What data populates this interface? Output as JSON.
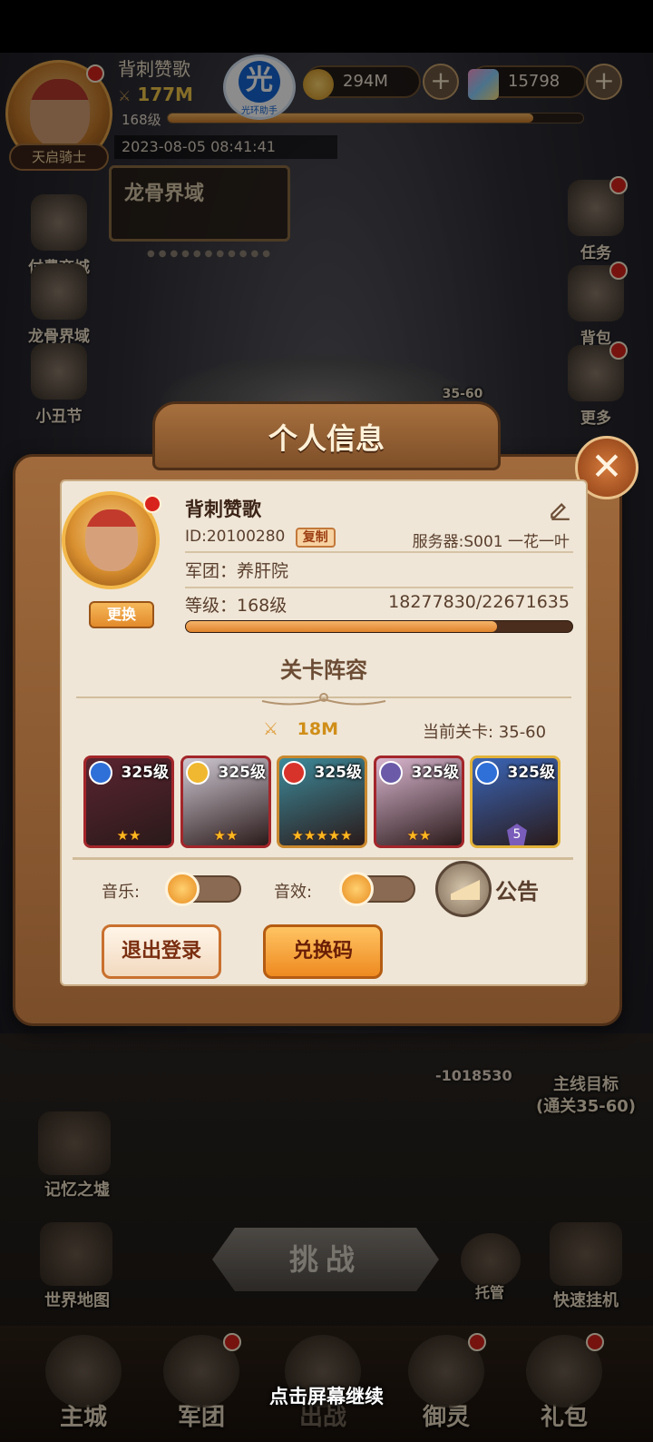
{
  "hud": {
    "player_name": "背刺赞歌",
    "power": "177M",
    "level": "168级",
    "title_tag": "天启骑士",
    "datetime": "2023-08-05 08:41:41",
    "logo_glyph": "光",
    "logo_text": "光环助手",
    "gold": "294M",
    "gems": "15798",
    "xp_fraction": 0.88
  },
  "left_sidebar": {
    "items": [
      {
        "label": "付费商城"
      },
      {
        "label": "龙骨界域"
      },
      {
        "label": "小丑节"
      }
    ],
    "banner_label": "龙骨界域"
  },
  "right_sidebar": {
    "items": [
      {
        "label": "任务"
      },
      {
        "label": "背包"
      },
      {
        "label": "更多"
      }
    ]
  },
  "scene": {
    "boss_stage": "35-60",
    "damage_text": "-1018530",
    "main_goal_line1": "主线目标",
    "main_goal_line2": "(通关35-60)",
    "memory_label": "记忆之墟",
    "world_map_label": "世界地图",
    "challenge_label": "挑战",
    "auto_label": "托管",
    "quick_idle_label": "快速挂机",
    "continue_tip": "点击屏幕继续"
  },
  "bottom_nav": {
    "items": [
      {
        "label": "主城"
      },
      {
        "label": "军团"
      },
      {
        "label": "出战"
      },
      {
        "label": "御灵"
      },
      {
        "label": "礼包"
      }
    ]
  },
  "modal": {
    "title": "个人信息",
    "name": "背刺赞歌",
    "id_text": "ID:20100280",
    "copy_label": "复制",
    "server_text": "服务器:S001 一花一叶",
    "guild_text": "军团：养肝院",
    "level_text": "等级：168级",
    "xp_text": "18277830/22671635",
    "xp_fraction": 0.806,
    "change_label": "更换",
    "section_title": "关卡阵容",
    "lineup_power": "18M",
    "current_stage": "当前关卡:   35-60",
    "heroes": [
      {
        "level": "325级",
        "stars": "★★",
        "frame_color": "#a3262a",
        "bg": "#5a2430",
        "elem_color": "#2f6fd8"
      },
      {
        "level": "325级",
        "stars": "★★",
        "frame_color": "#a3262a",
        "bg": "#cfc8d2",
        "elem_color": "#f0b830"
      },
      {
        "level": "325级",
        "stars": "★★★★★",
        "frame_color": "#c9882e",
        "bg": "#3d8a9a",
        "elem_color": "#d8332a"
      },
      {
        "level": "325级",
        "stars": "★★",
        "frame_color": "#a3262a",
        "bg": "#d9b6cf",
        "elem_color": "#6a5aa8"
      },
      {
        "level": "325级",
        "stars": "",
        "rank": "5",
        "frame_color": "#e2b23a",
        "bg": "#3a66b8",
        "elem_color": "#2f6fd8"
      }
    ],
    "music_label": "音乐:",
    "sfx_label": "音效:",
    "notice_label": "公告",
    "logout_label": "退出登录",
    "redeem_label": "兑换码"
  },
  "colors": {
    "accent_orange": "#e88c20",
    "frame_brown": "#7b4e2a",
    "panel_cream": "#efe6d7",
    "red_dot": "#d8231c"
  }
}
